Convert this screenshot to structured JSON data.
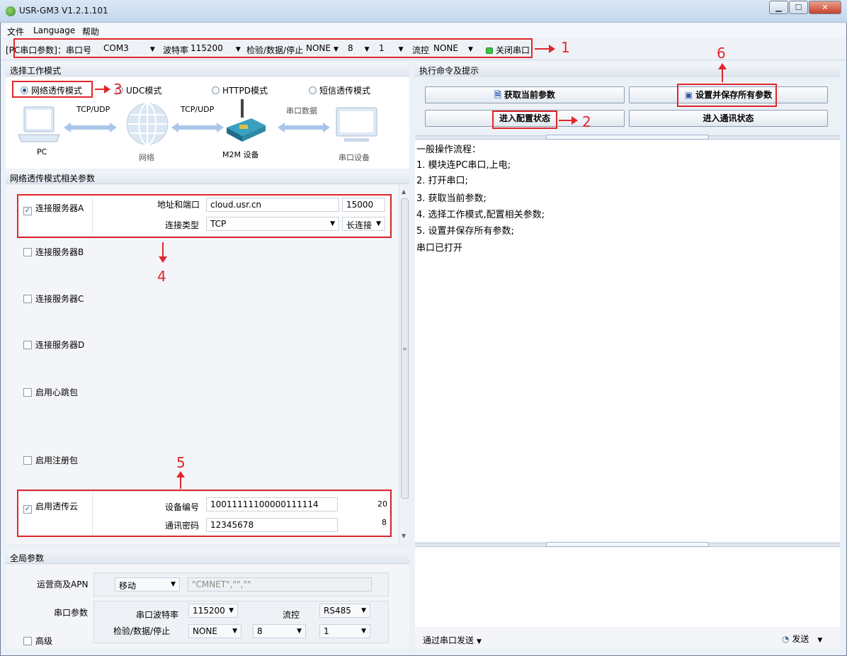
{
  "window": {
    "title": "USR-GM3 V1.2.1.101"
  },
  "menu": [
    "文件",
    "Language",
    "帮助"
  ],
  "serial_bar": {
    "prefix": "[PC串口参数]：串口号",
    "port": "COM3",
    "baud_label": "波特率",
    "baud": "115200",
    "check_label": "检验/数据/停止",
    "parity": "NONE",
    "databits": "8",
    "stopbits": "1",
    "flow_label": "流控",
    "flow": "NONE",
    "close_port": "关闭串口"
  },
  "annotations": {
    "a1": "1",
    "a2": "2",
    "a3": "3",
    "a4": "4",
    "a5": "5",
    "a6": "6"
  },
  "work_mode": {
    "header": "选择工作模式",
    "modes": [
      "网络透传模式",
      "UDC模式",
      "HTTPD模式",
      "短信透传模式"
    ],
    "diagram": {
      "pc": "PC",
      "network": "网络",
      "tcp1": "TCP/UDP",
      "tcp2": "TCP/UDP",
      "serial_data": "串口数据",
      "m2m": "M2M 设备",
      "serial_device": "串口设备"
    }
  },
  "net_params": {
    "header": "网络透传模式相关参数",
    "server_a": "连接服务器A",
    "addr_label": "地址和端口",
    "addr": "cloud.usr.cn",
    "port": "15000",
    "conn_type_label": "连接类型",
    "conn_type": "TCP",
    "conn_mode": "长连接",
    "server_b": "连接服务器B",
    "server_c": "连接服务器C",
    "server_d": "连接服务器D",
    "heartbeat": "启用心跳包",
    "register": "启用注册包",
    "cloud": "启用透传云",
    "device_id_label": "设备编号",
    "device_id": "10011111100000111114",
    "device_id_len": "20",
    "password_label": "通讯密码",
    "password": "12345678",
    "password_len": "8"
  },
  "global_params": {
    "header": "全局参数",
    "apn_label": "运营商及APN",
    "carrier": "移动",
    "apn": "\"CMNET\",\"\",\"\"",
    "serial_label": "串口参数",
    "baud_label": "串口波特率",
    "baud": "115200",
    "flow_label": "流控",
    "flow": "RS485",
    "check_label": "检验/数据/停止",
    "parity": "NONE",
    "databits": "8",
    "stopbits": "1",
    "advanced": "高级"
  },
  "commands": {
    "header": "执行命令及提示",
    "get_params": "获取当前参数",
    "save_params": "设置并保存所有参数",
    "enter_config": "进入配置状态",
    "enter_comm": "进入通讯状态"
  },
  "log": [
    "一般操作流程：",
    "1. 模块连PC串口,上电;",
    "2. 打开串口;",
    "3. 获取当前参数;",
    "4. 选择工作模式,配置相关参数;",
    "5. 设置并保存所有参数;",
    "串口已打开"
  ],
  "send_bar": {
    "via": "通过串口发送",
    "send": "发送"
  }
}
